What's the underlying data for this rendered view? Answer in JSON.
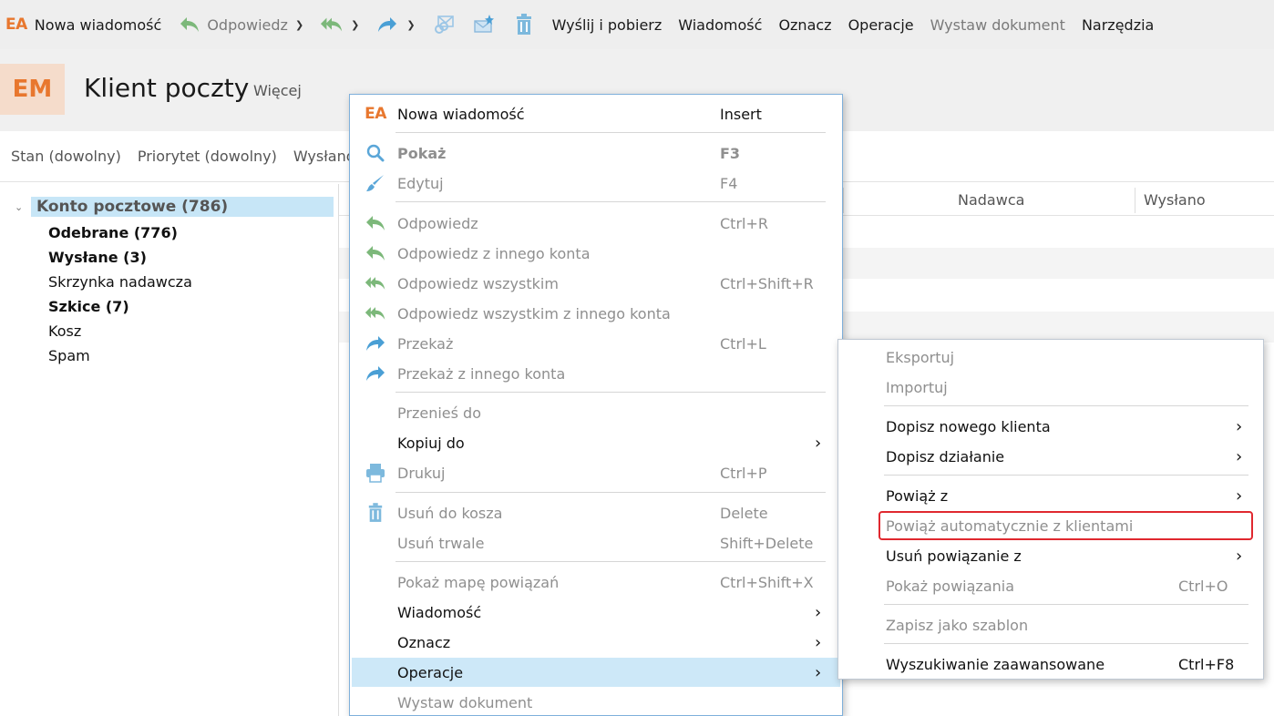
{
  "toolbar": {
    "new_message": "Nowa wiadomość",
    "reply": "Odpowiedz",
    "send_receive": "Wyślij i pobierz",
    "message": "Wiadomość",
    "mark": "Oznacz",
    "operations": "Operacje",
    "issue_document": "Wystaw dokument",
    "tools": "Narzędzia",
    "ea_logo": "EA"
  },
  "header": {
    "logo": "EM",
    "title": "Klient poczty",
    "more": "Więcej"
  },
  "filters": [
    "Stan (dowolny)",
    "Priorytet (dowolny)",
    "Wysłano"
  ],
  "tree": {
    "root": "Konto pocztowe (786)",
    "items": [
      {
        "label": "Odebrane (776)",
        "bold": true
      },
      {
        "label": "Wysłane (3)",
        "bold": true
      },
      {
        "label": "Skrzynka nadawcza",
        "bold": false
      },
      {
        "label": "Szkice (7)",
        "bold": true
      },
      {
        "label": "Kosz",
        "bold": false
      },
      {
        "label": "Spam",
        "bold": false
      }
    ]
  },
  "list": {
    "columns": [
      "Nadawca",
      "Wysłano"
    ]
  },
  "context_menu": {
    "items": [
      {
        "label": "Nowa wiadomość",
        "shortcut": "Insert",
        "icon": "ea-logo-icon"
      },
      {
        "label": "Pokaż",
        "shortcut": "F3",
        "icon": "search-icon"
      },
      {
        "label": "Edytuj",
        "shortcut": "F4",
        "icon": "brush-icon"
      },
      {
        "label": "Odpowiedz",
        "shortcut": "Ctrl+R",
        "icon": "reply-icon"
      },
      {
        "label": "Odpowiedz z innego konta",
        "shortcut": "",
        "icon": "reply-icon"
      },
      {
        "label": "Odpowiedz wszystkim",
        "shortcut": "Ctrl+Shift+R",
        "icon": "reply-all-icon"
      },
      {
        "label": "Odpowiedz wszystkim z innego konta",
        "shortcut": "",
        "icon": "reply-all-icon"
      },
      {
        "label": "Przekaż",
        "shortcut": "Ctrl+L",
        "icon": "forward-icon"
      },
      {
        "label": "Przekaż z innego konta",
        "shortcut": "",
        "icon": "forward-icon"
      },
      {
        "label": "Przenieś do",
        "shortcut": ""
      },
      {
        "label": "Kopiuj do",
        "shortcut": ""
      },
      {
        "label": "Drukuj",
        "shortcut": "Ctrl+P",
        "icon": "printer-icon"
      },
      {
        "label": "Usuń do kosza",
        "shortcut": "Delete",
        "icon": "trash-icon"
      },
      {
        "label": "Usuń trwale",
        "shortcut": "Shift+Delete"
      },
      {
        "label": "Pokaż mapę powiązań",
        "shortcut": "Ctrl+Shift+X"
      },
      {
        "label": "Wiadomość",
        "shortcut": ""
      },
      {
        "label": "Oznacz",
        "shortcut": ""
      },
      {
        "label": "Operacje",
        "shortcut": ""
      },
      {
        "label": "Wystaw dokument",
        "shortcut": ""
      }
    ]
  },
  "submenu": {
    "items": [
      {
        "label": "Eksportuj",
        "shortcut": ""
      },
      {
        "label": "Importuj",
        "shortcut": ""
      },
      {
        "label": "Dopisz nowego klienta",
        "shortcut": ""
      },
      {
        "label": "Dopisz działanie",
        "shortcut": ""
      },
      {
        "label": "Powiąż z",
        "shortcut": ""
      },
      {
        "label": "Powiąż automatycznie z klientami",
        "shortcut": ""
      },
      {
        "label": "Usuń powiązanie z",
        "shortcut": ""
      },
      {
        "label": "Pokaż powiązania",
        "shortcut": "Ctrl+O"
      },
      {
        "label": "Zapisz jako szablon",
        "shortcut": ""
      },
      {
        "label": "Wyszukiwanie zaawansowane",
        "shortcut": "Ctrl+F8"
      }
    ]
  },
  "colors": {
    "accent": "#e8772e",
    "selection": "#cde8f8",
    "highlight_border": "#e0282f",
    "icon_green": "#6aa84f",
    "icon_blue": "#4a9fd5"
  }
}
